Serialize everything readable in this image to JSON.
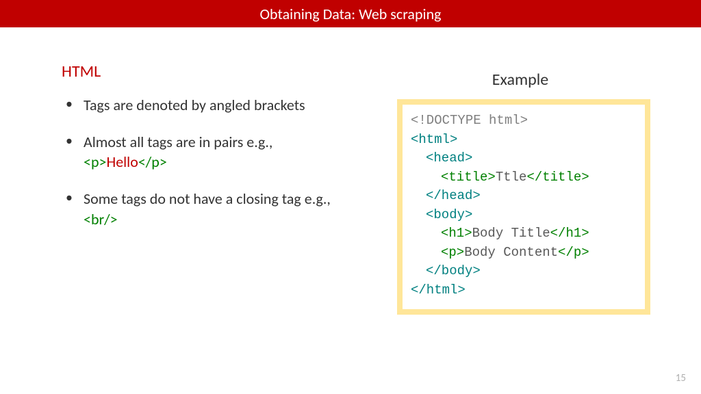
{
  "header": {
    "title": "Obtaining Data: Web scraping"
  },
  "left": {
    "heading": "HTML",
    "bullets": {
      "b1": "Tags are denoted by angled brackets",
      "b2_prefix": "Almost all tags are in pairs e.g., ",
      "b2_tag_open": "<p>",
      "b2_content": "Hello",
      "b2_tag_close": "</p>",
      "b3_prefix": "Some tags do not have a closing tag e.g., ",
      "b3_tag": "<br/>"
    }
  },
  "right": {
    "heading": "Example",
    "code": {
      "doctype": "<!DOCTYPE html>",
      "html_open": "<html>",
      "head_open": "<head>",
      "title_open": "<title>",
      "title_text": "Ttle",
      "title_close": "</title>",
      "head_close": "</head>",
      "body_open": "<body>",
      "h1_open": "<h1>",
      "h1_text": "Body Title",
      "h1_close": "</h1>",
      "p_open": "<p>",
      "p_text": "Body Content",
      "p_close": "</p>",
      "body_close": "</body>",
      "html_close": "</html>"
    }
  },
  "page_number": "15"
}
